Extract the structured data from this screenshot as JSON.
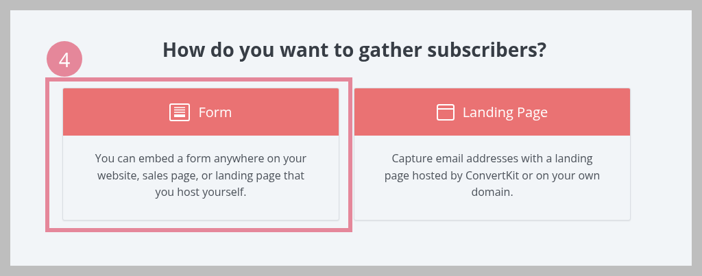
{
  "title": "How do you want to gather subscribers?",
  "options": [
    {
      "label": "Form",
      "kind": "form",
      "description": "You can embed a form anywhere on your website, sales page, or landing page that you host yourself.",
      "annotation": {
        "step": "4"
      }
    },
    {
      "label": "Landing Page",
      "kind": "landing_page",
      "description": "Capture email addresses with a landing page hosted by ConvertKit or on your own domain."
    }
  ]
}
